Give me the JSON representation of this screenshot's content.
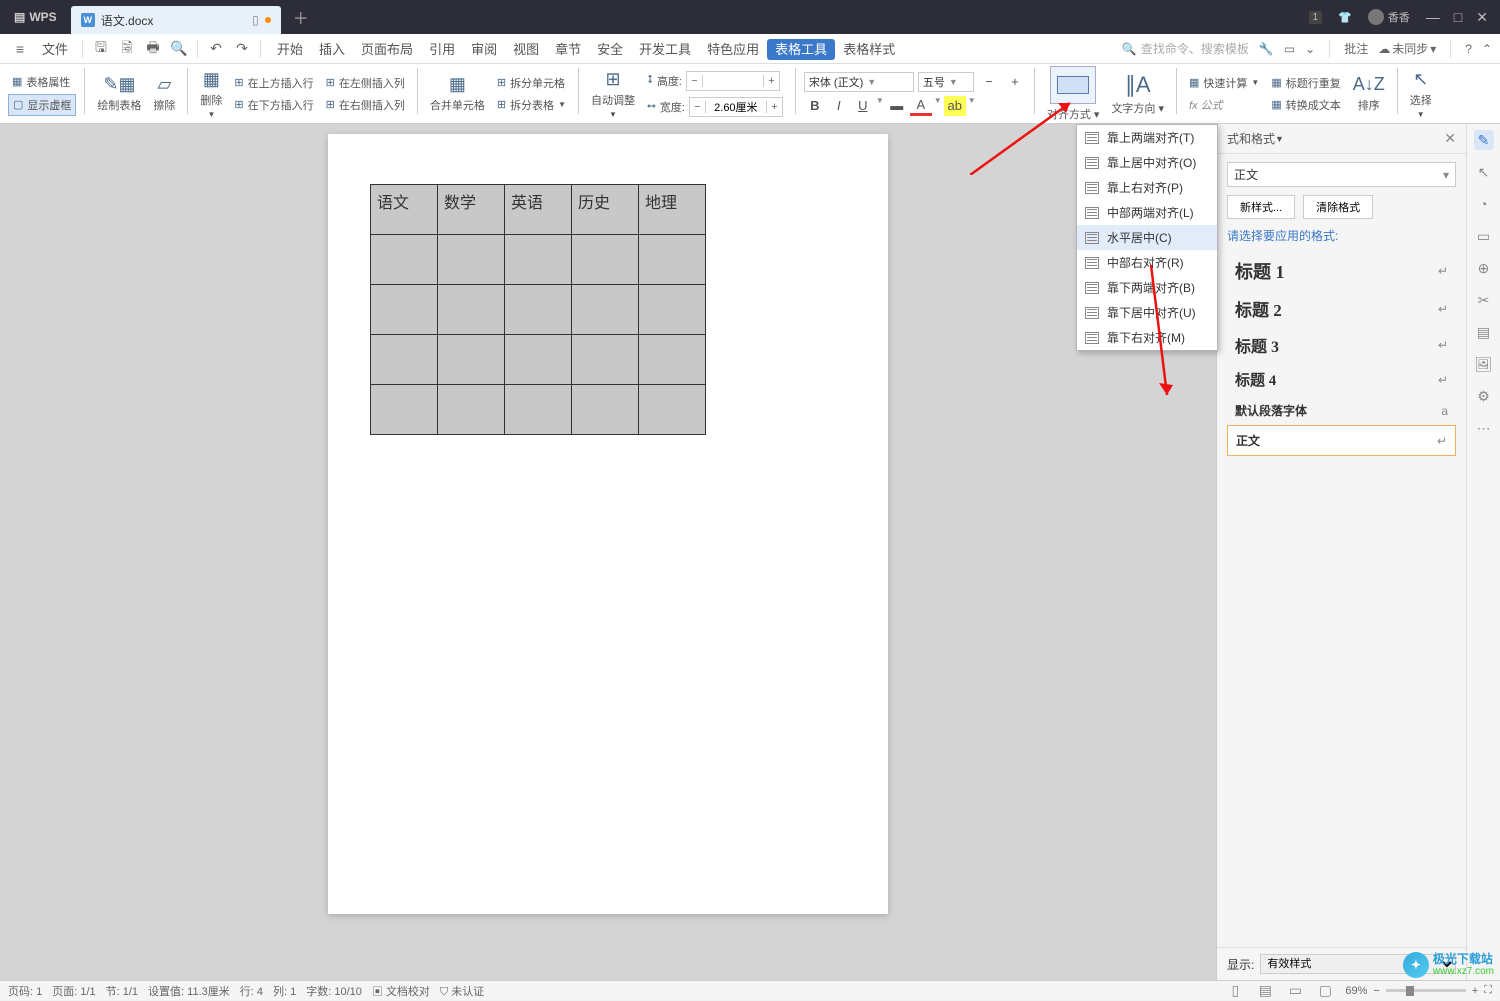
{
  "titlebar": {
    "app": "WPS",
    "doc": "语文.docx",
    "user": "香香",
    "badge": "1"
  },
  "menus": {
    "file": "文件",
    "items": [
      "开始",
      "插入",
      "页面布局",
      "引用",
      "审阅",
      "视图",
      "章节",
      "安全",
      "开发工具",
      "特色应用",
      "表格工具",
      "表格样式"
    ],
    "active_index": 10,
    "search_placeholder": "查找命令、搜索模板",
    "notes": "批注",
    "sync": "未同步"
  },
  "ribbon": {
    "table_props": "表格属性",
    "show_frame": "显示虚框",
    "draw": "绘制表格",
    "erase": "擦除",
    "delete": "删除",
    "ins_above": "在上方插入行",
    "ins_below": "在下方插入行",
    "ins_left": "在左侧插入列",
    "ins_right": "在右侧插入列",
    "merge": "合并单元格",
    "split_cell": "拆分单元格",
    "split_tbl": "拆分表格",
    "autofit": "自动调整",
    "height": "高度:",
    "width": "宽度:",
    "height_val": "",
    "width_val": "2.60厘米",
    "font": "宋体 (正文)",
    "size": "五号",
    "align": "对齐方式",
    "text_dir": "文字方向",
    "quick_calc": "快速计算",
    "header_repeat": "标题行重复",
    "to_text": "转换成文本",
    "sort": "排序",
    "fx": "fx 公式",
    "select": "选择"
  },
  "align_menu": {
    "items": [
      {
        "label": "靠上两端对齐(T)"
      },
      {
        "label": "靠上居中对齐(O)"
      },
      {
        "label": "靠上右对齐(P)"
      },
      {
        "label": "中部两端对齐(L)"
      },
      {
        "label": "水平居中(C)",
        "hov": true
      },
      {
        "label": "中部右对齐(R)"
      },
      {
        "label": "靠下两端对齐(B)"
      },
      {
        "label": "靠下居中对齐(U)"
      },
      {
        "label": "靠下右对齐(M)"
      }
    ]
  },
  "table": {
    "headers": [
      "语文",
      "数学",
      "英语",
      "历史",
      "地理"
    ],
    "rows": 4
  },
  "panel": {
    "title": "式和格式",
    "close": "×",
    "current": "正文",
    "new_style": "新样式...",
    "clear": "清除格式",
    "hint": "请选择要应用的格式:",
    "styles": [
      {
        "n": "标题 1",
        "m": "↵",
        "c": "h1"
      },
      {
        "n": "标题 2",
        "m": "↵",
        "c": "h2"
      },
      {
        "n": "标题 3",
        "m": "↵",
        "c": "h3"
      },
      {
        "n": "标题 4",
        "m": "↵",
        "c": "h4"
      },
      {
        "n": "默认段落字体",
        "m": "a",
        "c": "def"
      },
      {
        "n": "正文",
        "m": "↵",
        "c": "body",
        "sel": true
      }
    ],
    "show": "显示:",
    "show_val": "有效样式"
  },
  "status": {
    "page_no": "页码: 1",
    "page": "页面: 1/1",
    "sec": "节: 1/1",
    "set": "设置值: 11.3厘米",
    "row": "行: 4",
    "col": "列: 1",
    "words": "字数: 10/10",
    "proof": "文档校对",
    "cert": "未认证",
    "zoom": "69%"
  },
  "watermark": {
    "l1": "极光下载站",
    "l2": "www.xz7.com"
  }
}
